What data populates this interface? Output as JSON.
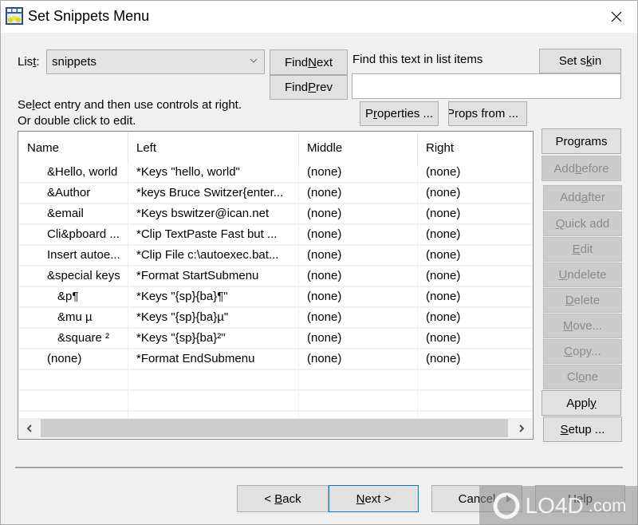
{
  "window": {
    "title": "Set Snippets Menu",
    "close_icon": "close-icon"
  },
  "list_selector": {
    "label": "List:",
    "label_underline_char": "t",
    "value": "snippets"
  },
  "find": {
    "next_label_pre": "Find ",
    "next_label_u": "N",
    "next_label_post": "ext",
    "prev_label_pre": "Find ",
    "prev_label_u": "P",
    "prev_label_post": "rev",
    "prompt": "Find this text in list items",
    "input_value": ""
  },
  "buttons_top": {
    "set_skin_pre": "Set s",
    "set_skin_u": "k",
    "set_skin_post": "in",
    "properties_pre": "P",
    "properties_u": "r",
    "properties_post": "operties ...",
    "props_from": "Props from ..."
  },
  "instructions": {
    "line1_pre": "Se",
    "line1_u": "l",
    "line1_post": "ect entry and then use controls at right.",
    "line2": "Or double click to edit."
  },
  "table": {
    "columns": [
      "Name",
      "Left",
      "Middle",
      "Right"
    ],
    "rows": [
      {
        "name": "&Hello, world",
        "indent": 1,
        "left": "*Keys \"hello, world\"",
        "middle": "(none)",
        "right": "(none)"
      },
      {
        "name": "&Author",
        "indent": 1,
        "left": "*keys Bruce Switzer{enter...",
        "middle": "(none)",
        "right": "(none)"
      },
      {
        "name": "&email",
        "indent": 1,
        "left": "*Keys bswitzer@ican.net",
        "middle": "(none)",
        "right": "(none)"
      },
      {
        "name": "Cli&pboard ...",
        "indent": 1,
        "left": "*Clip TextPaste Fast but ...",
        "middle": "(none)",
        "right": "(none)"
      },
      {
        "name": "Insert autoe...",
        "indent": 1,
        "left": "*Clip File  c:\\autoexec.bat...",
        "middle": "(none)",
        "right": "(none)"
      },
      {
        "name": "&special keys",
        "indent": 1,
        "left": "*Format StartSubmenu",
        "middle": "(none)",
        "right": "(none)"
      },
      {
        "name": "&p¶",
        "indent": 2,
        "left": "*Keys  \"{sp}{ba}¶\"",
        "middle": "(none)",
        "right": "(none)"
      },
      {
        "name": "&mu µ",
        "indent": 2,
        "left": "*Keys \"{sp}{ba}µ\"",
        "middle": "(none)",
        "right": "(none)"
      },
      {
        "name": "&square ²",
        "indent": 2,
        "left": "*Keys \"{sp}{ba}²\"",
        "middle": "(none)",
        "right": "(none)"
      },
      {
        "name": "(none)",
        "indent": 0,
        "left": "*Format EndSubmenu",
        "middle": "(none)",
        "right": "(none)"
      }
    ],
    "empty_rows": 3
  },
  "side_buttons": [
    {
      "id": "programs",
      "pre": "Programs",
      "u": "",
      "post": "",
      "disabled": false
    },
    {
      "id": "add-before",
      "pre": "Add ",
      "u": "b",
      "post": "efore",
      "disabled": true
    },
    {
      "id": "add-after",
      "pre": "Add ",
      "u": "a",
      "post": "fter",
      "disabled": true
    },
    {
      "id": "quick-add",
      "pre": "",
      "u": "Q",
      "post": "uick add",
      "disabled": true
    },
    {
      "id": "edit",
      "pre": "",
      "u": "E",
      "post": "dit",
      "disabled": true
    },
    {
      "id": "undelete",
      "pre": "",
      "u": "U",
      "post": "ndelete",
      "disabled": true
    },
    {
      "id": "delete",
      "pre": "",
      "u": "D",
      "post": "elete",
      "disabled": true
    },
    {
      "id": "move",
      "pre": "",
      "u": "M",
      "post": "ove...",
      "disabled": true
    },
    {
      "id": "copy",
      "pre": "",
      "u": "C",
      "post": "opy...",
      "disabled": true
    },
    {
      "id": "clone",
      "pre": "Cl",
      "u": "o",
      "post": "ne",
      "disabled": true
    },
    {
      "id": "apply",
      "pre": "Appl",
      "u": "y",
      "post": "",
      "disabled": false
    },
    {
      "id": "setup",
      "pre": "",
      "u": "S",
      "post": "etup ...",
      "disabled": false
    }
  ],
  "footer": {
    "back_pre": "< ",
    "back_u": "B",
    "back_post": "ack",
    "next_pre": "",
    "next_u": "N",
    "next_post": "ext >",
    "cancel": "Cancel",
    "help": "Help"
  },
  "watermark": {
    "text": "LO4D",
    "suffix": ".com"
  }
}
